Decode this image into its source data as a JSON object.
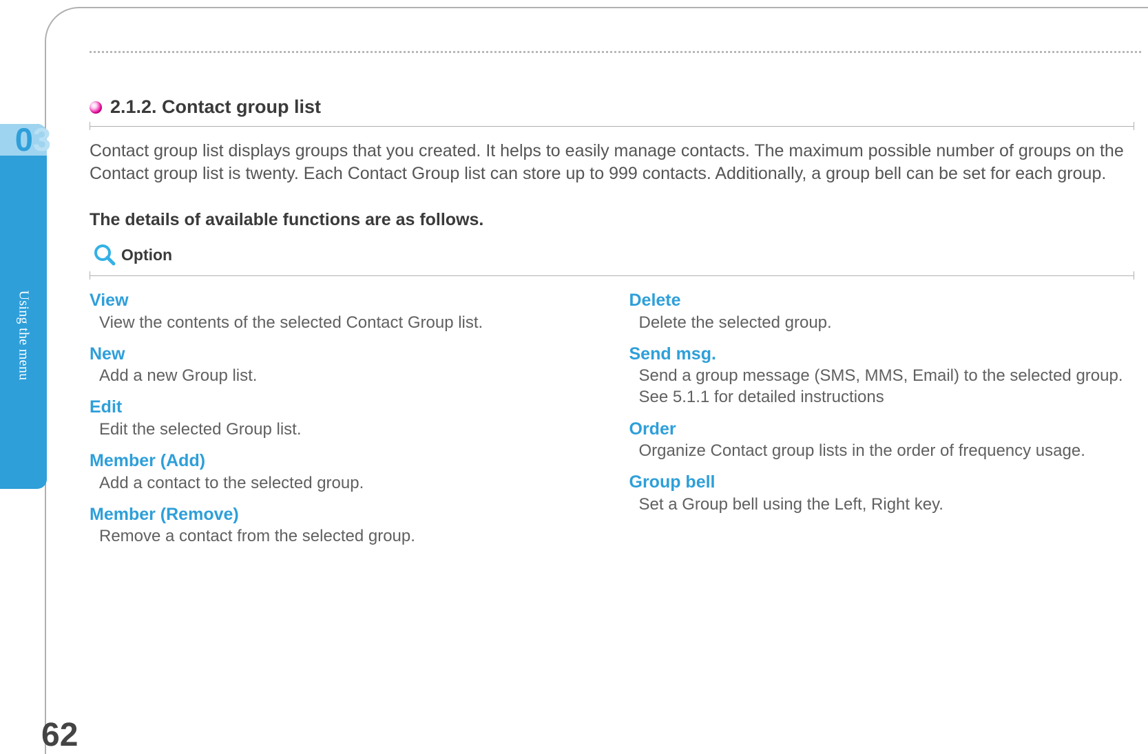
{
  "chapter": {
    "number_d1": "0",
    "number_d2": "3",
    "label": "Using the menu"
  },
  "page_number": "62",
  "section": {
    "number_title": "2.1.2. Contact group list",
    "intro": "Contact group list displays groups that you created. It helps to easily manage contacts. The maximum possible number of groups on the Contact group list is twenty. Each Contact Group list can store up to 999 contacts. Additionally, a group bell can be set for each group.",
    "details_heading": "The details of available functions are as follows.",
    "option_label": "Option"
  },
  "options_left": [
    {
      "title": "View",
      "desc": "View the contents of the selected Contact Group list."
    },
    {
      "title": "New",
      "desc": "Add a new Group list."
    },
    {
      "title": "Edit",
      "desc": "Edit the selected Group list."
    },
    {
      "title": "Member (Add)",
      "desc": "Add a contact to the selected group."
    },
    {
      "title": "Member (Remove)",
      "desc": "Remove a contact from the selected group."
    }
  ],
  "options_right": [
    {
      "title": "Delete",
      "desc": "Delete the selected group."
    },
    {
      "title": "Send msg.",
      "desc": "Send a group message (SMS, MMS, Email) to the selected group.\nSee 5.1.1 for detailed instructions"
    },
    {
      "title": "Order",
      "desc": "Organize Contact group lists in the order of frequency usage."
    },
    {
      "title": "Group bell",
      "desc": "Set a Group bell using the  Left, Right key."
    }
  ]
}
